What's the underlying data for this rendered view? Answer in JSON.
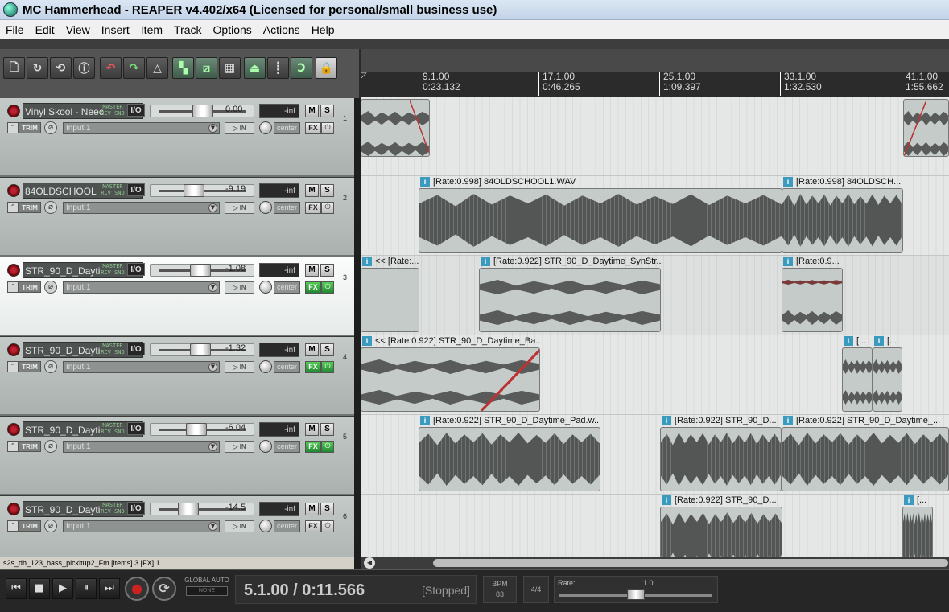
{
  "window": {
    "title": "MC Hammerhead - REAPER v4.402/x64 (Licensed for personal/small business use)"
  },
  "menu": [
    "File",
    "Edit",
    "View",
    "Insert",
    "Item",
    "Track",
    "Options",
    "Actions",
    "Help"
  ],
  "ruler": [
    {
      "bar": "9.1.00",
      "time": "0:23.132"
    },
    {
      "bar": "17.1.00",
      "time": "0:46.265"
    },
    {
      "bar": "25.1.00",
      "time": "1:09.397"
    },
    {
      "bar": "33.1.00",
      "time": "1:32.530"
    },
    {
      "bar": "41.1.00",
      "time": "1:55.662"
    }
  ],
  "tracks": [
    {
      "number": "1",
      "name": "Vinyl Skool - Neec",
      "master": "MASTER",
      "snd": "RCV SND",
      "io": "I/O",
      "volume": "0.00",
      "meter": "-inf",
      "mute": "M",
      "solo": "S",
      "trim": "TRIM",
      "input": "Input 1",
      "monitor": "IN",
      "pan": "center",
      "fx": "FX",
      "fx_active": false,
      "selected": false,
      "fader": 0.5
    },
    {
      "number": "2",
      "name": "84OLDSCHOOL",
      "master": "MASTER",
      "snd": "RCV SND",
      "io": "I/O",
      "volume": "-9.19",
      "meter": "-inf",
      "mute": "M",
      "solo": "S",
      "trim": "TRIM",
      "input": "Input 1",
      "monitor": "IN",
      "pan": "center",
      "fx": "FX",
      "fx_active": false,
      "selected": false,
      "fader": 0.38
    },
    {
      "number": "3",
      "name": "STR_90_D_Dayti",
      "master": "MASTER",
      "snd": "RCV SND",
      "io": "I/O",
      "volume": "-1.08",
      "meter": "-inf",
      "mute": "M",
      "solo": "S",
      "trim": "TRIM",
      "input": "Input 1",
      "monitor": "IN",
      "pan": "center",
      "fx": "FX",
      "fx_active": true,
      "selected": true,
      "fader": 0.47
    },
    {
      "number": "4",
      "name": "STR_90_D_Dayti",
      "master": "MASTER",
      "snd": "RCV SND",
      "io": "I/O",
      "volume": "-1.32",
      "meter": "-inf",
      "mute": "M",
      "solo": "S",
      "trim": "TRIM",
      "input": "Input 1",
      "monitor": "IN",
      "pan": "center",
      "fx": "FX",
      "fx_active": true,
      "selected": false,
      "fader": 0.47
    },
    {
      "number": "5",
      "name": "STR_90_D_Dayti",
      "master": "MASTER",
      "snd": "RCV SND",
      "io": "I/O",
      "volume": "-6.04",
      "meter": "-inf",
      "mute": "M",
      "solo": "S",
      "trim": "TRIM",
      "input": "Input 1",
      "monitor": "IN",
      "pan": "center",
      "fx": "FX",
      "fx_active": true,
      "selected": false,
      "fader": 0.41
    },
    {
      "number": "6",
      "name": "STR_90_D_Dayti",
      "master": "MASTER",
      "snd": "RCV SND",
      "io": "I/O",
      "volume": "-14.5",
      "meter": "-inf",
      "mute": "M",
      "solo": "S",
      "trim": "TRIM",
      "input": "Input 1",
      "monitor": "IN",
      "pan": "center",
      "fx": "FX",
      "fx_active": false,
      "selected": false,
      "fader": 0.3
    }
  ],
  "items": {
    "t2a": "[Rate:0.998] 84OLDSCHOOL1.WAV",
    "t2b": "[Rate:0.998] 84OLDSCH...",
    "t3a": "<< [Rate:...",
    "t3b": "[Rate:0.922] STR_90_D_Daytime_SynStr...",
    "t3c": "[Rate:0.9...",
    "t4a": "<< [Rate:0.922] STR_90_D_Daytime_Ba...",
    "t4b": "[...",
    "t4c": "[...",
    "t5a": "[Rate:0.922] STR_90_D_Daytime_Pad.w...",
    "t5b": "[Rate:0.922] STR_90_D...",
    "t5c": "[Rate:0.922] STR_90_D_Daytime_...",
    "t6a": "[Rate:0.922] STR_90_D...",
    "t6b": "[..."
  },
  "status": "s2s_dh_123_bass_pickitup2_Fm [items] 3 [FX] 1",
  "transport": {
    "global_auto": "GLOBAL AUTO",
    "auto_mode": "NONE",
    "position": "5.1.00 / 0:11.566",
    "state": "[Stopped]",
    "bpm_label": "BPM",
    "bpm": "83",
    "timesig": "4/4",
    "rate_label": "Rate:",
    "rate_value": "1.0"
  }
}
